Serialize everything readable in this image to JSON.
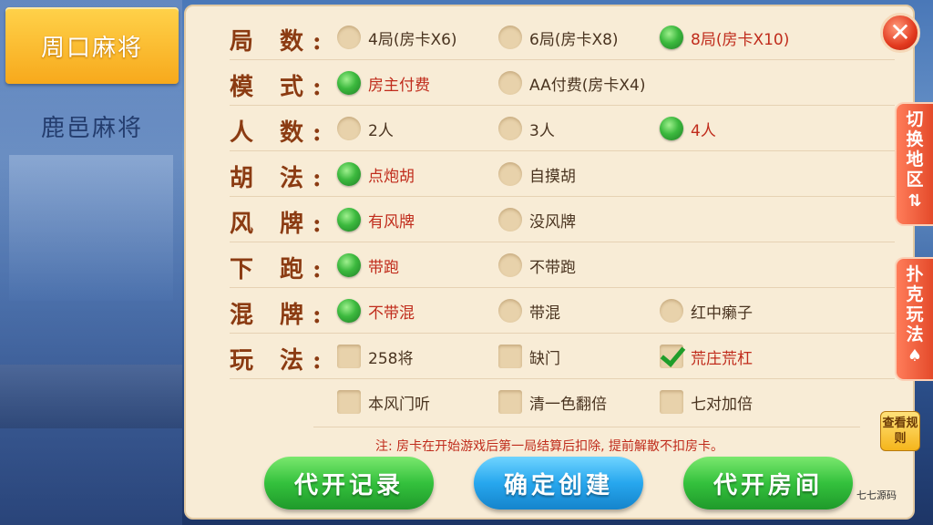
{
  "sidebar": {
    "items": [
      {
        "label": "周口麻将",
        "active": true
      },
      {
        "label": "鹿邑麻将",
        "active": false
      }
    ]
  },
  "rows": [
    {
      "label": "局 数:",
      "options": [
        {
          "text": "4局(房卡X6)",
          "selected": false
        },
        {
          "text": "6局(房卡X8)",
          "selected": false
        },
        {
          "text": "8局(房卡X10)",
          "selected": true
        }
      ]
    },
    {
      "label": "模 式:",
      "options": [
        {
          "text": "房主付费",
          "selected": true
        },
        {
          "text": "AA付费(房卡X4)",
          "selected": false
        }
      ]
    },
    {
      "label": "人 数:",
      "options": [
        {
          "text": "2人",
          "selected": false
        },
        {
          "text": "3人",
          "selected": false
        },
        {
          "text": "4人",
          "selected": true
        }
      ]
    },
    {
      "label": "胡 法:",
      "options": [
        {
          "text": "点炮胡",
          "selected": true
        },
        {
          "text": "自摸胡",
          "selected": false
        }
      ]
    },
    {
      "label": "风 牌:",
      "options": [
        {
          "text": "有风牌",
          "selected": true
        },
        {
          "text": "没风牌",
          "selected": false
        }
      ]
    },
    {
      "label": "下 跑:",
      "options": [
        {
          "text": "带跑",
          "selected": true
        },
        {
          "text": "不带跑",
          "selected": false
        }
      ]
    },
    {
      "label": "混 牌:",
      "options": [
        {
          "text": "不带混",
          "selected": true
        },
        {
          "text": "带混",
          "selected": false
        },
        {
          "text": "红中癞子",
          "selected": false
        }
      ]
    },
    {
      "label": "玩 法:",
      "options": [
        {
          "text": "258将",
          "checked": false
        },
        {
          "text": "缺门",
          "checked": false
        },
        {
          "text": "荒庄荒杠",
          "checked": true
        }
      ]
    },
    {
      "label": "",
      "options": [
        {
          "text": "本风门听",
          "checked": false
        },
        {
          "text": "清一色翻倍",
          "checked": false
        },
        {
          "text": "七对加倍",
          "checked": false
        }
      ]
    }
  ],
  "note": "注: 房卡在开始游戏后第一局结算后扣除, 提前解散不扣房卡。",
  "buttons": {
    "record": "代开记录",
    "create": "确定创建",
    "proxy": "代开房间"
  },
  "close_label": "✕",
  "side_tabs": {
    "region": "切换地区",
    "region_icon": "⇅",
    "poker": "扑克玩法",
    "poker_icon": "♠"
  },
  "rules_label": "查看规则",
  "watermark": "七七源码"
}
